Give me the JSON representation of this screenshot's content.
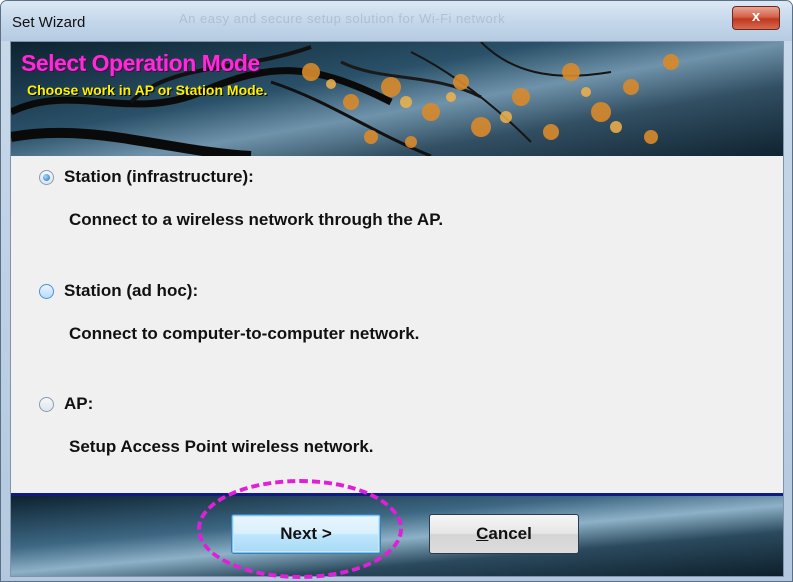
{
  "window": {
    "title": "Set Wizard",
    "ghost_caption": "An easy and secure setup solution for Wi-Fi network",
    "close_label": "x"
  },
  "banner": {
    "title": "Select Operation Mode",
    "subtitle": "Choose work in AP or Station Mode."
  },
  "options": [
    {
      "label": "Station (infrastructure):",
      "description": "Connect to a wireless network through the AP.",
      "selected": true
    },
    {
      "label": "Station (ad hoc):",
      "description": "Connect to computer-to-computer network.",
      "selected": false
    },
    {
      "label": "AP:",
      "description": "Setup Access Point wireless network.",
      "selected": false
    }
  ],
  "buttons": {
    "next": "Next >",
    "cancel_mnemonic": "C",
    "cancel_rest": "ancel"
  },
  "colors": {
    "banner_title": "#ff2ad4",
    "banner_subtitle": "#fff100",
    "annotation": "#e020d8",
    "divider": "#101c86"
  }
}
